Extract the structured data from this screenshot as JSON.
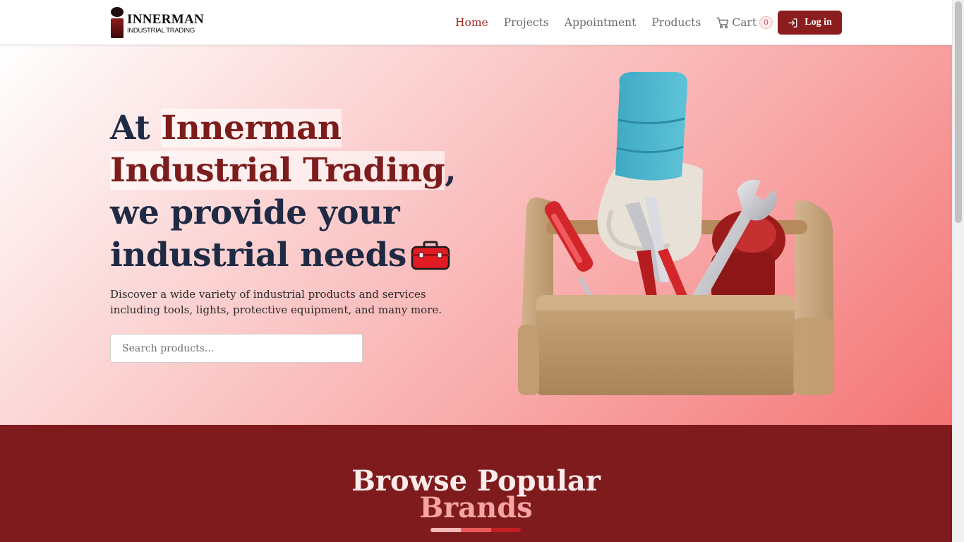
{
  "nav": {
    "logo_name": "INNERMAN",
    "logo_sub": "INDUSTRIAL TRADING",
    "links": [
      "Home",
      "Projects",
      "Appointment",
      "Products"
    ],
    "active": "Home",
    "cart_label": "Cart",
    "cart_count": "0",
    "login_label": "Log in"
  },
  "hero": {
    "headline_prefix": "At ",
    "headline_highlight_1": "Innerman",
    "headline_highlight_2": "Industrial Trading",
    "headline_comma": ",",
    "headline_line_3": "we provide your",
    "headline_line_4": "industrial needs",
    "headline_icon": "toolbox-icon",
    "description": "Discover a wide variety of industrial products and services including tools, lights, protective equipment, and many more.",
    "search_placeholder": "Search products...",
    "illustration": "toolbox-hand-illustration"
  },
  "brands": {
    "title": "Browse Popular",
    "subtitle": "Brands",
    "bar_colors": [
      "#f6b9b9",
      "#ea5a5a",
      "#c21f22"
    ]
  },
  "colors": {
    "brand": "#8a1d1d",
    "accent": "#a4282a",
    "section_bg": "#7f1b1d",
    "heading": "#1f2a44"
  }
}
